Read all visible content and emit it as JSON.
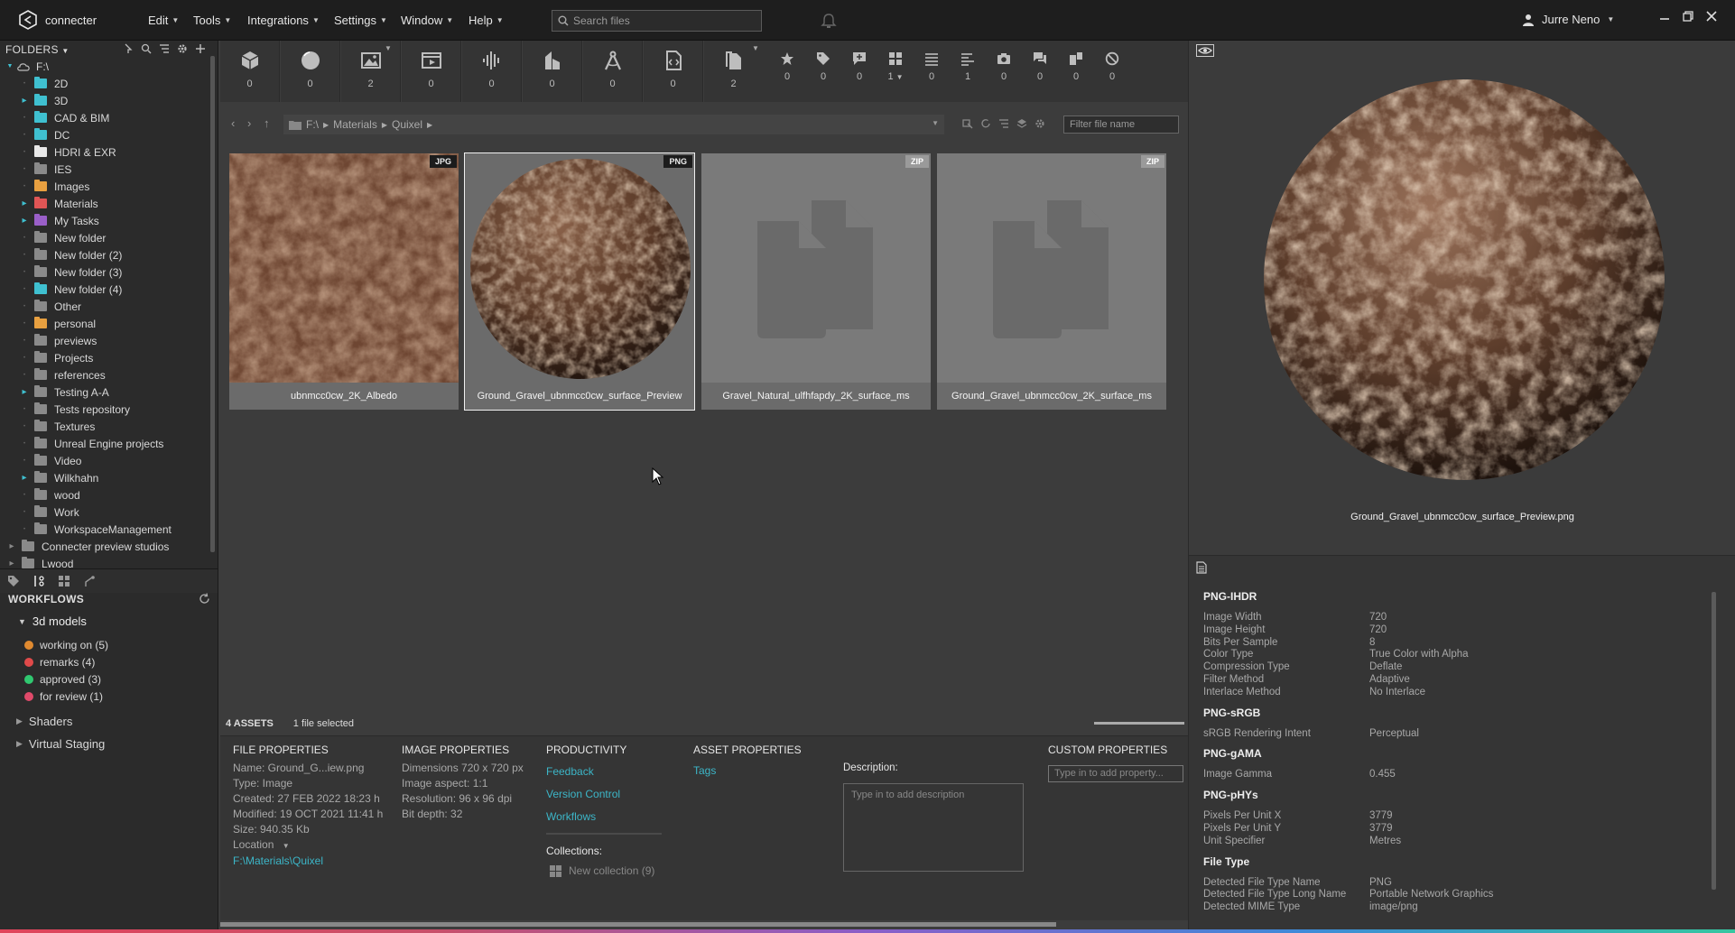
{
  "app": {
    "name": "connecter"
  },
  "menus": [
    "Edit",
    "Tools",
    "Integrations",
    "Settings",
    "Window",
    "Help"
  ],
  "search": {
    "placeholder": "Search files"
  },
  "user": {
    "name": "Jurre Neno"
  },
  "folders": {
    "header": "FOLDERS",
    "root": "F:\\",
    "items": [
      {
        "label": "2D",
        "color": "#3fc0d0",
        "expand": false
      },
      {
        "label": "3D",
        "color": "#3fc0d0",
        "expand": true
      },
      {
        "label": "CAD & BIM",
        "color": "#3fc0d0",
        "expand": false
      },
      {
        "label": "DC",
        "color": "#3fc0d0",
        "expand": false
      },
      {
        "label": "HDRI & EXR",
        "color": "#e8e8e8",
        "expand": false
      },
      {
        "label": "IES",
        "color": "#8a8a8a",
        "expand": false
      },
      {
        "label": "Images",
        "color": "#e8a040",
        "expand": false
      },
      {
        "label": "Materials",
        "color": "#e05555",
        "expand": true
      },
      {
        "label": "My Tasks",
        "color": "#9a5fc8",
        "expand": true
      },
      {
        "label": "New folder",
        "color": "#8a8a8a",
        "expand": false
      },
      {
        "label": "New folder (2)",
        "color": "#8a8a8a",
        "expand": false
      },
      {
        "label": "New folder (3)",
        "color": "#8a8a8a",
        "expand": false
      },
      {
        "label": "New folder (4)",
        "color": "#3fc0d0",
        "expand": false
      },
      {
        "label": "Other",
        "color": "#8a8a8a",
        "expand": false
      },
      {
        "label": "personal",
        "color": "#e8a040",
        "expand": false
      },
      {
        "label": "previews",
        "color": "#8a8a8a",
        "expand": false
      },
      {
        "label": "Projects",
        "color": "#8a8a8a",
        "expand": false
      },
      {
        "label": "references",
        "color": "#8a8a8a",
        "expand": false
      },
      {
        "label": "Testing A-A",
        "color": "#8a8a8a",
        "expand": true
      },
      {
        "label": "Tests repository",
        "color": "#8a8a8a",
        "expand": false
      },
      {
        "label": "Textures",
        "color": "#8a8a8a",
        "expand": false
      },
      {
        "label": "Unreal Engine projects",
        "color": "#8a8a8a",
        "expand": false
      },
      {
        "label": "Video",
        "color": "#8a8a8a",
        "expand": false
      },
      {
        "label": "Wilkhahn",
        "color": "#8a8a8a",
        "expand": true
      },
      {
        "label": "wood",
        "color": "#8a8a8a",
        "expand": false
      },
      {
        "label": "Work",
        "color": "#8a8a8a",
        "expand": false
      },
      {
        "label": "WorkspaceManagement",
        "color": "#8a8a8a",
        "expand": false
      }
    ],
    "extra": [
      "Connecter preview studios",
      "Lwood"
    ]
  },
  "workflows": {
    "header": "WORKFLOWS",
    "group": "3d models",
    "items": [
      {
        "label": "working on  (5)",
        "color": "#e08a30"
      },
      {
        "label": "remarks  (4)",
        "color": "#e04a4a"
      },
      {
        "label": "approved  (3)",
        "color": "#30c870"
      },
      {
        "label": "for review  (1)",
        "color": "#e04a6a"
      }
    ],
    "other": [
      "Shaders",
      "Virtual Staging"
    ]
  },
  "toolbar": {
    "type_counts": [
      "0",
      "0",
      "2",
      "0",
      "0",
      "0",
      "0",
      "0",
      "2"
    ],
    "filter_counts": [
      "0",
      "0",
      "0",
      "1",
      "0",
      "1",
      "0",
      "0",
      "0",
      "0"
    ]
  },
  "path": {
    "crumbs": [
      "F:\\",
      "Materials",
      "Quixel"
    ],
    "filter_placeholder": "Filter file name"
  },
  "assets": [
    {
      "name": "ubnmcc0cw_2K_Albedo",
      "badge": "JPG"
    },
    {
      "name": "Ground_Gravel_ubnmcc0cw_surface_Preview",
      "badge": "PNG"
    },
    {
      "name": "Gravel_Natural_ulfhfapdy_2K_surface_ms",
      "badge": "ZIP"
    },
    {
      "name": "Ground_Gravel_ubnmcc0cw_2K_surface_ms",
      "badge": "ZIP"
    }
  ],
  "summary": {
    "assets": "4 ASSETS",
    "selected": "1 file selected"
  },
  "props": {
    "file": {
      "title": "FILE PROPERTIES",
      "name": "Name: Ground_G...iew.png",
      "type": "Type: Image",
      "created": "Created: 27 FEB 2022 18:23 h",
      "modified": "Modified: 19 OCT 2021 11:41 h",
      "size": "Size: 940.35 Kb",
      "location_label": "Location",
      "location": "F:\\Materials\\Quixel"
    },
    "image": {
      "title": "IMAGE PROPERTIES",
      "dimensions": "Dimensions 720 x 720 px",
      "aspect": "Image aspect: 1:1",
      "resolution": "Resolution: 96 x 96 dpi",
      "bitdepth": "Bit depth: 32"
    },
    "productivity": {
      "title": "PRODUCTIVITY",
      "links": [
        "Feedback",
        "Version Control",
        "Workflows"
      ],
      "collections_label": "Collections:",
      "new_collection": "New collection  (9)"
    },
    "asset": {
      "title": "ASSET PROPERTIES",
      "tags": "Tags"
    },
    "description": {
      "label": "Description:",
      "placeholder": "Type in to add description"
    },
    "custom": {
      "title": "CUSTOM PROPERTIES",
      "placeholder": "Type in to add property..."
    }
  },
  "preview": {
    "filename": "Ground_Gravel_ubnmcc0cw_surface_Preview.png"
  },
  "metadata": [
    {
      "section": "PNG-IHDR",
      "rows": [
        [
          "Image Width",
          "720"
        ],
        [
          "Image Height",
          "720"
        ],
        [
          "Bits Per Sample",
          "8"
        ],
        [
          "Color Type",
          "True Color with Alpha"
        ],
        [
          "Compression Type",
          "Deflate"
        ],
        [
          "Filter Method",
          "Adaptive"
        ],
        [
          "Interlace Method",
          "No Interlace"
        ]
      ]
    },
    {
      "section": "PNG-sRGB",
      "rows": [
        [
          "sRGB Rendering Intent",
          "Perceptual"
        ]
      ]
    },
    {
      "section": "PNG-gAMA",
      "rows": [
        [
          "Image Gamma",
          "0.455"
        ]
      ]
    },
    {
      "section": "PNG-pHYs",
      "rows": [
        [
          "Pixels Per Unit X",
          "3779"
        ],
        [
          "Pixels Per Unit Y",
          "3779"
        ],
        [
          "Unit Specifier",
          "Metres"
        ]
      ]
    },
    {
      "section": "File Type",
      "rows": [
        [
          "Detected File Type Name",
          "PNG"
        ],
        [
          "Detected File Type Long Name",
          "Portable Network Graphics"
        ],
        [
          "Detected MIME Type",
          "image/png"
        ]
      ]
    }
  ]
}
